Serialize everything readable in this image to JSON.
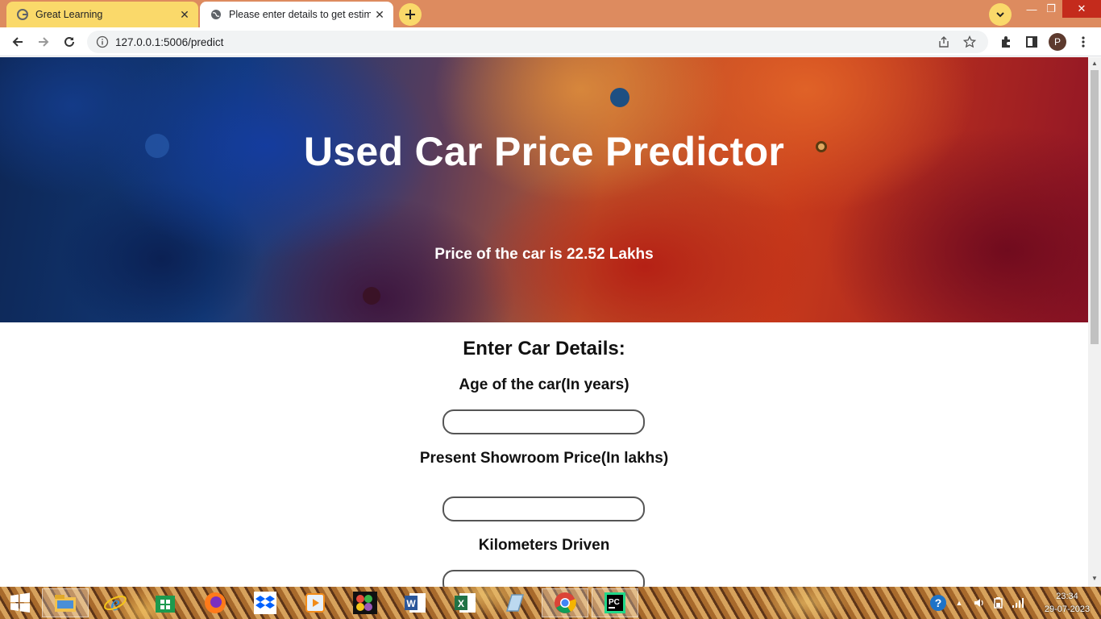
{
  "browser": {
    "tabs": [
      {
        "title": "Great Learning",
        "favicon": "google-g-icon"
      },
      {
        "title": "Please enter details to get estima",
        "favicon": "globe-icon"
      }
    ],
    "url": "127.0.0.1:5006/predict",
    "profile_initial": "P"
  },
  "page": {
    "title": "Used Car Price Predictor",
    "result": "Price of the car is 22.52 Lakhs",
    "form_title": "Enter Car Details:",
    "fields": [
      {
        "label": "Age of the car(In years)",
        "value": ""
      },
      {
        "label": "Present Showroom Price(In lakhs)",
        "value": ""
      },
      {
        "label": "Kilometers Driven",
        "value": ""
      }
    ]
  },
  "taskbar": {
    "apps": [
      "windows-start-icon",
      "file-explorer-icon",
      "internet-explorer-icon",
      "store-icon",
      "firefox-icon",
      "dropbox-icon",
      "media-player-icon",
      "photos-icon",
      "word-icon",
      "excel-icon",
      "notepad-icon",
      "chrome-icon",
      "pycharm-icon"
    ],
    "time": "23:34",
    "date": "29-07-2023"
  },
  "colors": {
    "tabstrip": "#dd8b5f",
    "tab_inactive": "#fad96a",
    "close_button": "#c42b1c"
  }
}
